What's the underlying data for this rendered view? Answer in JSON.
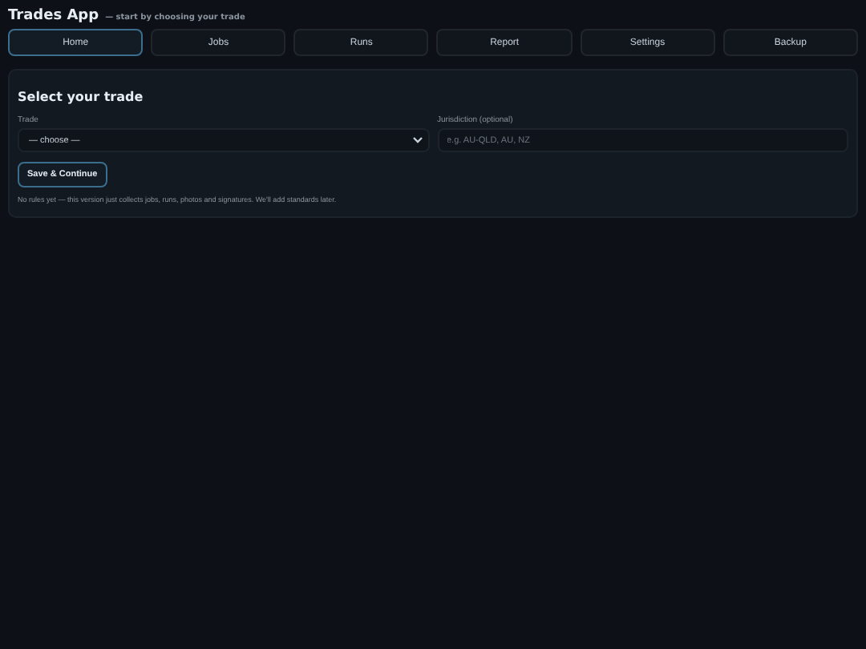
{
  "header": {
    "title": "Trades App",
    "subtitle": "— start by choosing your trade"
  },
  "tabs": [
    {
      "label": "Home",
      "selected": true
    },
    {
      "label": "Jobs",
      "selected": false
    },
    {
      "label": "Runs",
      "selected": false
    },
    {
      "label": "Report",
      "selected": false
    },
    {
      "label": "Settings",
      "selected": false
    },
    {
      "label": "Backup",
      "selected": false
    }
  ],
  "card": {
    "title": "Select your trade",
    "trade": {
      "label": "Trade",
      "value": "— choose —"
    },
    "jurisdiction": {
      "label": "Jurisdiction (optional)",
      "placeholder": "e.g. AU-QLD, AU, NZ"
    },
    "button": "Save & Continue",
    "note": "No rules yet — this version just collects jobs, runs, photos and signatures. We'll add standards later."
  }
}
